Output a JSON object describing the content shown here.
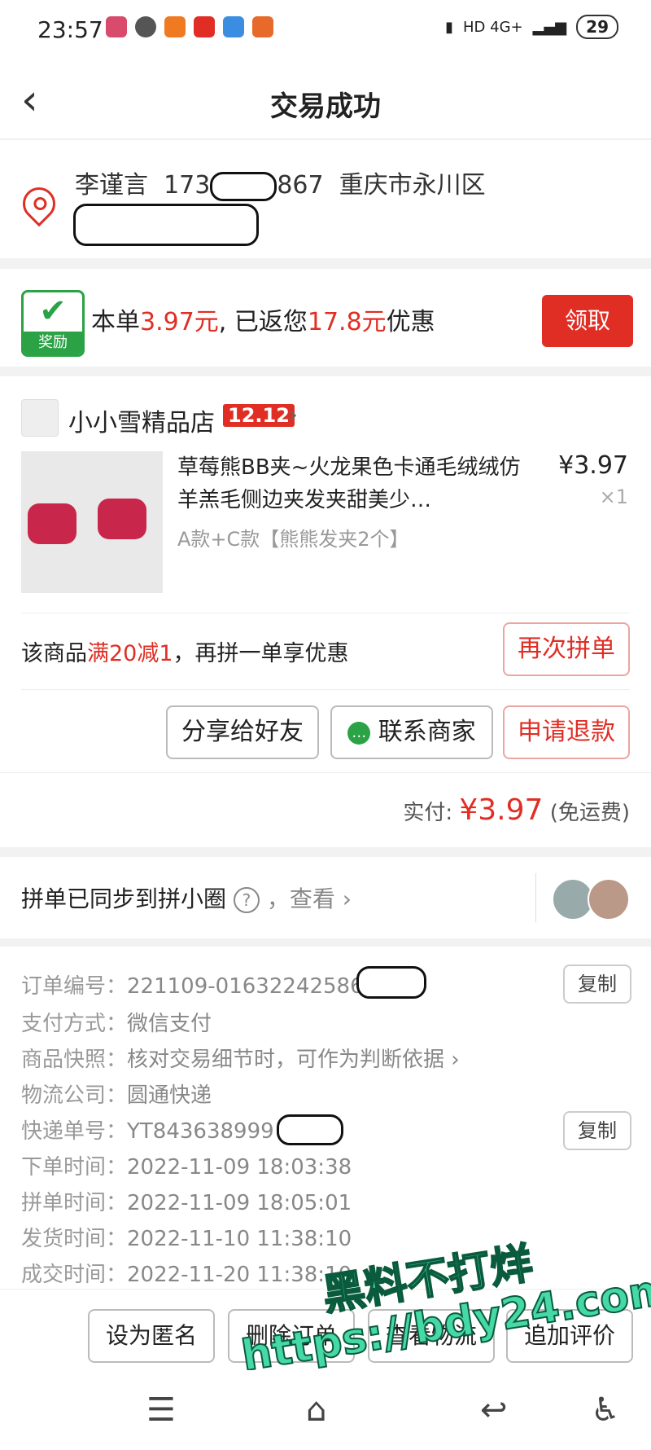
{
  "status": {
    "time": "23:57",
    "network": "HD 4G+",
    "battery": "29"
  },
  "header": {
    "back_icon": "‹",
    "title": "交易成功"
  },
  "address": {
    "name": "李谨言",
    "phone_prefix": "173",
    "phone_suffix": "867",
    "region": "重庆市永川区"
  },
  "reward": {
    "badge": "奖励",
    "text_pre": "本单",
    "amount": "3.97元",
    "text_mid": ", 已返您",
    "discount": "17.8元",
    "text_post": "优惠",
    "claim_button": "领取"
  },
  "store": {
    "name": "小小雪精品店",
    "tag": "12.12",
    "arrow": "›"
  },
  "product": {
    "name": "草莓熊BB夹~火龙果色卡通毛绒绒仿羊羔毛侧边夹发夹甜美少…",
    "variant": "A款+C款【熊熊发夹2个】",
    "price": "¥3.97",
    "qty": "×1"
  },
  "promo": {
    "text_pre": "该商品",
    "highlight": "满20减1",
    "text_post": "，再拼一单享优惠",
    "button": "再次拼单"
  },
  "buttons": {
    "share": "分享给好友",
    "contact": "联系商家",
    "refund": "申请退款"
  },
  "paid": {
    "label": "实付:",
    "amount": "¥3.97",
    "note": "(免运费)"
  },
  "circle": {
    "text": "拼单已同步到拼小圈",
    "help": "?",
    "view": "，查看 ›"
  },
  "details": {
    "order_no_label": "订单编号：",
    "order_no": "221109-01632242586",
    "pay_label": "支付方式：",
    "pay": "微信支付",
    "snapshot_label": "商品快照：",
    "snapshot": "核对交易细节时，可作为判断依据 ›",
    "logistics_label": "物流公司：",
    "logistics": "圆通快递",
    "tracking_label": "快递单号：",
    "tracking": "YT843638999",
    "order_time_label": "下单时间：",
    "order_time": "2022-11-09 18:03:38",
    "group_time_label": "拼单时间：",
    "group_time": "2022-11-09 18:05:01",
    "ship_time_label": "发货时间：",
    "ship_time": "2022-11-10 11:38:10",
    "deal_time_label": "成交时间：",
    "deal_time": "2022-11-20 11:38:10",
    "copy": "复制"
  },
  "actions": {
    "anon": "设为匿名",
    "delete": "删除订单",
    "logistics": "查看物流",
    "review": "追加评价"
  },
  "watermark": {
    "line1": "黑料不打烊",
    "line2": "https://bdy24.com"
  },
  "sysnav": {
    "menu": "☰",
    "home": "⌂",
    "back": "↩",
    "access": "♿"
  }
}
